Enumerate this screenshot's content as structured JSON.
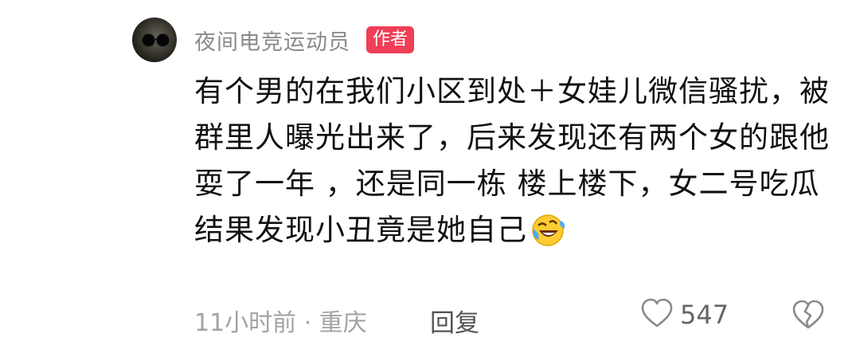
{
  "comment": {
    "username": "夜间电竞运动员",
    "author_badge": "作者",
    "text": "有个男的在我们小区到处＋女娃儿微信骚扰，被群里人曝光出来了，后来发现还有两个女的跟他耍了一年 ，还是同一栋 楼上楼下，女二号吃瓜结果发现小丑竟是她自己",
    "emoji": "rolling-on-floor-laughing",
    "time_location": "11小时前 · 重庆",
    "reply_label": "回复",
    "like_count": "547",
    "icons": {
      "like": "heart-outline-icon",
      "dislike": "broken-heart-icon"
    },
    "colors": {
      "badge": "#f03e56",
      "meta_text": "#a3a3a3"
    }
  }
}
